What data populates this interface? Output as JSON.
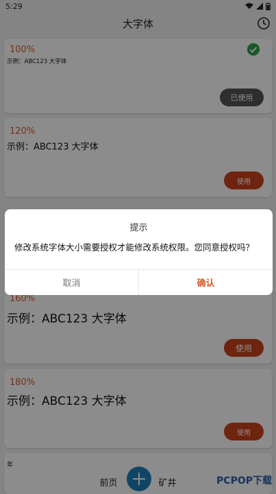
{
  "status_bar": {
    "time": "5:29"
  },
  "header": {
    "title": "大字体",
    "history_icon": "clock-icon"
  },
  "items": [
    {
      "percent": "100%",
      "sample": "示例：ABC123 大字体",
      "button": "已使用",
      "selected": true
    },
    {
      "percent": "120%",
      "sample": "示例：ABC123 大字体",
      "button": "使用",
      "selected": false
    },
    {
      "percent": "160%",
      "sample": "示例：ABC123 大字体",
      "button": "使用",
      "selected": false
    },
    {
      "percent": "180%",
      "sample": "示例：ABC123 大字体",
      "button": "使用",
      "selected": false
    },
    {
      "percent": "",
      "sample": "年",
      "button": "",
      "selected": false
    }
  ],
  "dialog": {
    "title": "提示",
    "message": "修改系统字体大小需要授权才能修改系统权限。您同意授权吗？",
    "cancel": "取消",
    "confirm": "确认"
  },
  "bottom_nav": {
    "left_label": "前页",
    "right_label": "矿井",
    "fab_icon": "plus-icon"
  },
  "watermark": "PCPOP下载",
  "colors": {
    "accent": "#c8431b",
    "percent": "#d9592a",
    "used_button": "#555555",
    "check": "#2fa34a",
    "fab": "#1f7fb8"
  }
}
